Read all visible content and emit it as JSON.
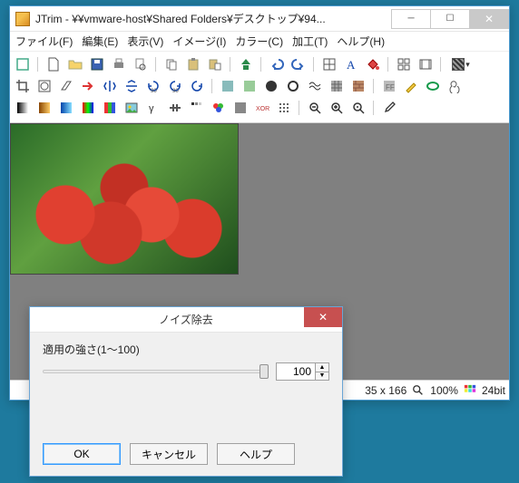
{
  "window": {
    "title": "JTrim - ¥¥vmware-host¥Shared Folders¥デスクトップ¥94..."
  },
  "menu": {
    "file": "ファイル(F)",
    "edit": "編集(E)",
    "view": "表示(V)",
    "image": "イメージ(I)",
    "color": "カラー(C)",
    "process": "加工(T)",
    "help": "ヘルプ(H)"
  },
  "status": {
    "size": "35 x 166",
    "zoom": "100%",
    "depth": "24bit"
  },
  "dialog": {
    "title": "ノイズ除去",
    "strength_label": "適用の強さ(1～100)",
    "value": "100",
    "ok": "OK",
    "cancel": "キャンセル",
    "help": "ヘルプ"
  }
}
